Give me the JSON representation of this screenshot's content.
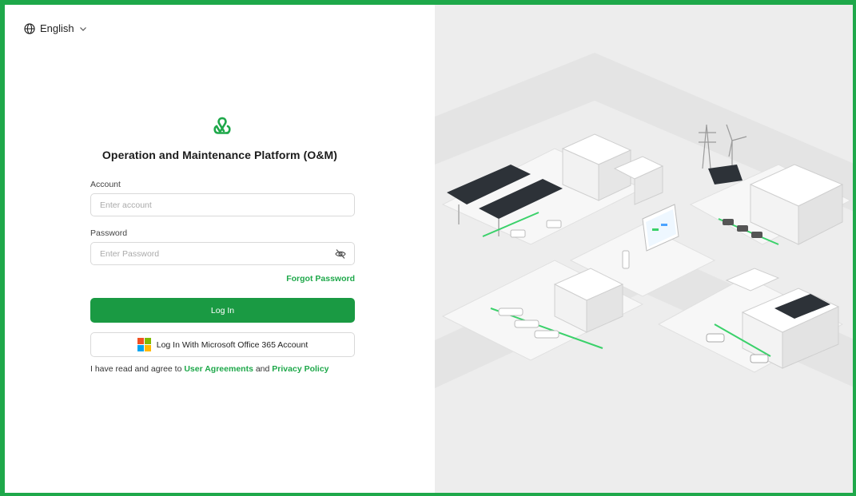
{
  "language": {
    "label": "English",
    "icon": "globe-icon",
    "chevron": "chevron-down-icon"
  },
  "brand": {
    "logo_icon": "platform-logo-icon",
    "title": "Operation and Maintenance Platform (O&M)"
  },
  "account": {
    "label": "Account",
    "placeholder": "Enter account",
    "value": ""
  },
  "password": {
    "label": "Password",
    "placeholder": "Enter Password",
    "value": "",
    "toggle_icon": "eye-off-icon"
  },
  "forgot_password": "Forgot Password",
  "login_button": "Log In",
  "microsoft_button": {
    "label": "Log In With Microsoft Office 365 Account",
    "icon": "microsoft-logo-icon"
  },
  "agreement": {
    "prefix": "I have read and agree to",
    "user_agreements": "User Agreements",
    "conjunction": "and",
    "privacy_policy": "Privacy Policy"
  },
  "colors": {
    "accent": "#1ea84a",
    "button": "#1a9a43",
    "frame": "#1ea84a",
    "illustration_bg": "#ededed"
  }
}
